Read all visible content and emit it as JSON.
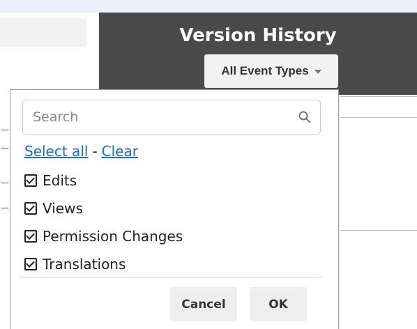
{
  "header": {
    "title": "Version History",
    "event_type_filter": {
      "selected": "All Event Types",
      "caret_icon": "caret-down-icon"
    }
  },
  "dropdown": {
    "search": {
      "placeholder": "Search",
      "value": "",
      "icon": "search-icon"
    },
    "select_all_label": "Select all",
    "separator": "-",
    "clear_label": "Clear",
    "options": [
      {
        "label": "Edits",
        "checked": true
      },
      {
        "label": "Views",
        "checked": true
      },
      {
        "label": "Permission Changes",
        "checked": true
      },
      {
        "label": "Translations",
        "checked": true
      }
    ],
    "cancel_label": "Cancel",
    "ok_label": "OK"
  },
  "colors": {
    "header_bg": "#4a4a4a",
    "link": "#1a6fc9",
    "button_bg": "#eeeeee",
    "top_strip": "#eaf1fb"
  }
}
